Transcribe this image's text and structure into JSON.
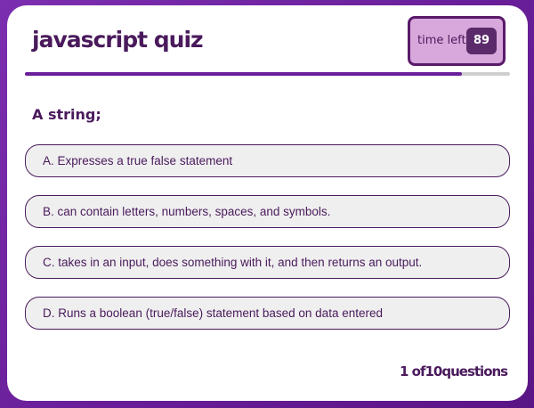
{
  "header": {
    "title": "javascript quiz",
    "timer_label": "time left",
    "timer_value": "89"
  },
  "progress": {
    "fraction": 0.9
  },
  "question": {
    "text": "A string;"
  },
  "answers": [
    {
      "label": "A. Expresses a true false statement"
    },
    {
      "label": "B. can contain letters, numbers, spaces, and symbols."
    },
    {
      "label": "C. takes in an input, does something with it, and then returns an output."
    },
    {
      "label": "D. Runs a boolean (true/false) statement based on data entered"
    }
  ],
  "footer": {
    "counter": "1 of10questions"
  }
}
